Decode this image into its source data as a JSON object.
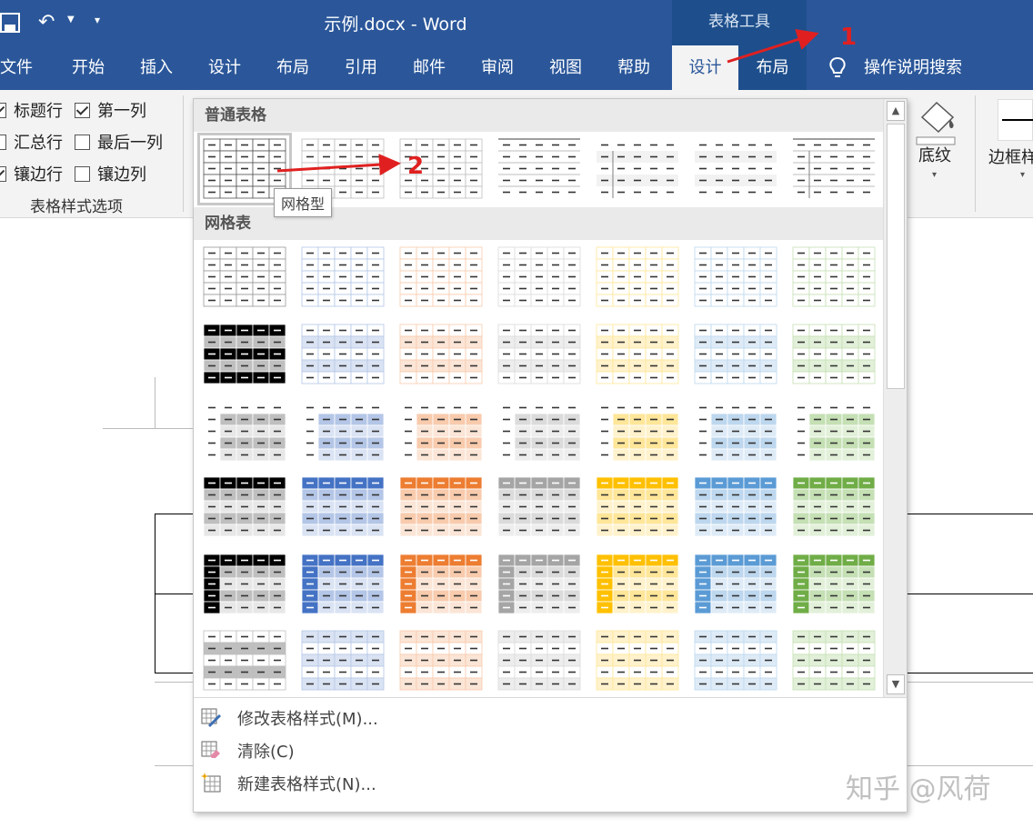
{
  "colors": {
    "ribbon_blue": "#2b579a",
    "context_blue": "#1e4f8c",
    "annotation_red": "#e02020"
  },
  "titlebar": {
    "doc_title": "示例.docx  -  Word",
    "context_group": "表格工具"
  },
  "tabs": {
    "file": "文件",
    "home": "开始",
    "insert": "插入",
    "design": "设计",
    "layout": "布局",
    "references": "引用",
    "mailings": "邮件",
    "review": "审阅",
    "view": "视图",
    "help": "帮助",
    "table_design": "设计",
    "table_layout": "布局",
    "tell_me": "操作说明搜索"
  },
  "style_options": {
    "header_row": {
      "label": "标题行",
      "checked": true
    },
    "first_column": {
      "label": "第一列",
      "checked": true
    },
    "total_row": {
      "label": "汇总行",
      "checked": false
    },
    "last_column": {
      "label": "最后一列",
      "checked": false
    },
    "banded_rows": {
      "label": "镶边行",
      "checked": true
    },
    "banded_columns": {
      "label": "镶边列",
      "checked": false
    },
    "group_label": "表格样式选项"
  },
  "ribbon_right": {
    "shading": "底纹",
    "border_styles": "边框样"
  },
  "gallery": {
    "plain_tables": "普通表格",
    "grid_tables": "网格表",
    "tooltip": "网格型",
    "modify": "修改表格样式(M)...",
    "clear": "清除(C)",
    "new_style": "新建表格样式(N)...",
    "plain_styles": [
      {
        "name": "grid",
        "dark": "#000000",
        "light": "#ffffff",
        "border": "#555555",
        "kind": "plain-grid"
      },
      {
        "name": "plain-1",
        "dark": "#bfbfbf",
        "light": "#ffffff",
        "border": "#bfbfbf",
        "kind": "plain-grid"
      },
      {
        "name": "plain-2",
        "dark": "#bfbfbf",
        "light": "#ffffff",
        "border": "#bfbfbf",
        "kind": "plain-grid"
      },
      {
        "name": "plain-3",
        "dark": "#7f7f7f",
        "light": "#ffffff",
        "border": "#7f7f7f",
        "kind": "plain-lines"
      },
      {
        "name": "plain-4",
        "dark": "#7f7f7f",
        "light": "#f2f2f2",
        "border": "#7f7f7f",
        "kind": "plain-band-col"
      },
      {
        "name": "plain-5",
        "dark": "#bfbfbf",
        "light": "#f2f2f2",
        "border": "#ffffff",
        "kind": "plain-band"
      },
      {
        "name": "plain-6",
        "dark": "#7f7f7f",
        "light": "#ffffff",
        "border": "#7f7f7f",
        "kind": "plain-lines-col"
      }
    ],
    "accents": [
      {
        "dark": "#000000",
        "mid": "#bfbfbf",
        "light": "#e7e7e7"
      },
      {
        "dark": "#4472c4",
        "mid": "#b4c6e7",
        "light": "#dae3f3"
      },
      {
        "dark": "#ed7d31",
        "mid": "#f8cbad",
        "light": "#fbe5d6"
      },
      {
        "dark": "#a5a5a5",
        "mid": "#dbdbdb",
        "light": "#ededed"
      },
      {
        "dark": "#ffc000",
        "mid": "#ffe699",
        "light": "#fff2cc"
      },
      {
        "dark": "#5b9bd5",
        "mid": "#bdd7ee",
        "light": "#deebf7"
      },
      {
        "dark": "#70ad47",
        "mid": "#c5e0b4",
        "light": "#e2f0d9"
      }
    ],
    "grid_row_kinds": [
      "grid-1-light",
      "grid-2",
      "grid-3",
      "grid-4",
      "grid-5-dark",
      "grid-6-colorful"
    ]
  },
  "annotations": {
    "step1": "1",
    "step2": "2"
  },
  "watermark": "知乎 @风荷"
}
